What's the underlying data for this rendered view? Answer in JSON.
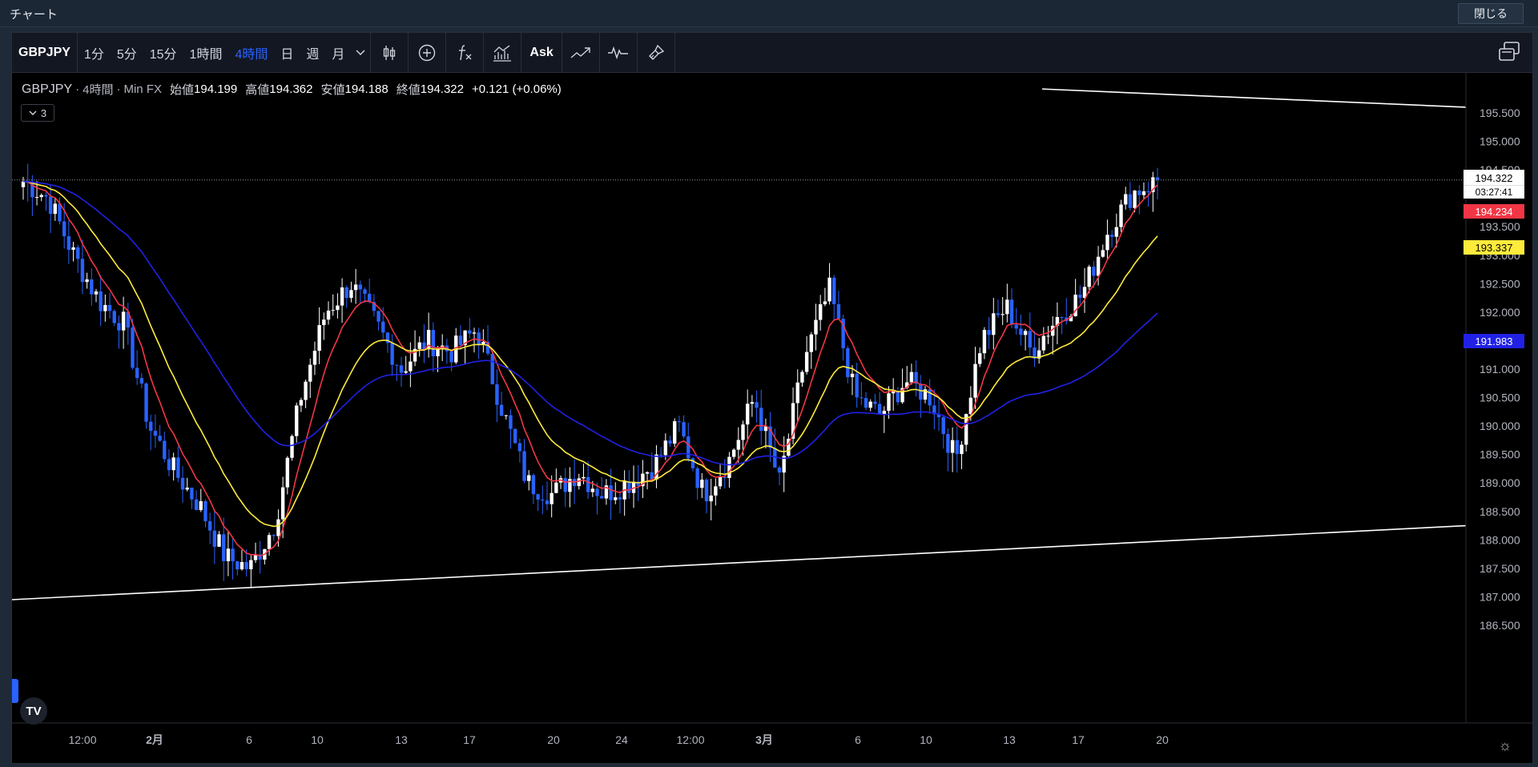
{
  "window": {
    "title": "チャート",
    "close_label": "閉じる"
  },
  "toolbar": {
    "symbol": "GBPJPY",
    "intervals": [
      "1分",
      "5分",
      "15分",
      "1時間",
      "4時間",
      "日",
      "週",
      "月"
    ],
    "active_interval": "4時間",
    "interval_dropdown_icon": "chevron-down-icon",
    "icons": [
      "candles-icon",
      "add-compare-icon",
      "indicators-fx-icon",
      "templates-icon"
    ],
    "ask_label": "Ask",
    "icons_right": [
      "line-tool-icon",
      "replay-icon",
      "brush-icon"
    ],
    "layout_icon": "multi-window-icon"
  },
  "legend": {
    "symbol": "GBPJPY",
    "interval": "4時間",
    "source": "Min FX",
    "open_label": "始値",
    "open": "194.199",
    "high_label": "高値",
    "high": "194.362",
    "low_label": "安値",
    "low": "194.188",
    "close_label": "終値",
    "close": "194.322",
    "change": "+0.121 (+0.06%)",
    "collapse_label": "3"
  },
  "price_tags": {
    "last": "194.322",
    "countdown": "03:27:41",
    "ma_red": "194.234",
    "ma_yellow": "193.337",
    "ma_blue": "191.983"
  },
  "colors": {
    "background": "#000000",
    "up_candle": "#ffffff",
    "down_candle": "#2962ff",
    "ma_fast": "#f23645",
    "ma_mid": "#ffeb3b",
    "ma_slow": "#2121e6",
    "trendline": "#ffffff"
  },
  "chart_data": {
    "type": "candlestick",
    "symbol": "GBPJPY",
    "interval": "4時間",
    "y_axis": {
      "ticks": [
        "195.500",
        "195.000",
        "194.500",
        "193.500",
        "193.000",
        "192.500",
        "192.000",
        "191.500",
        "191.000",
        "190.500",
        "190.000",
        "189.500",
        "189.000",
        "188.500",
        "188.000",
        "187.500",
        "187.000",
        "186.500"
      ],
      "range": [
        186.3,
        195.8
      ]
    },
    "x_axis": {
      "ticks": [
        "12:00",
        "2月",
        "6",
        "10",
        "13",
        "17",
        "20",
        "24",
        "12:00",
        "3月",
        "6",
        "10",
        "13",
        "17",
        "20"
      ],
      "bold_ticks": [
        "2月",
        "3月"
      ]
    },
    "price_anchors": [
      194.3,
      194.0,
      193.0,
      192.2,
      191.8,
      190.0,
      189.2,
      188.6,
      187.7,
      187.5,
      188.3,
      190.5,
      192.0,
      192.5,
      191.8,
      191.0,
      191.5,
      191.3,
      191.7,
      190.3,
      189.0,
      188.8,
      189.2,
      188.8,
      189.0,
      189.3,
      190.0,
      188.8,
      189.4,
      190.5,
      189.0,
      191.2,
      192.4,
      190.5,
      190.2,
      190.8,
      190.5,
      189.4,
      191.5,
      192.1,
      191.3,
      191.9,
      192.3,
      193.4,
      194.1,
      194.3
    ],
    "moving_averages": [
      {
        "color": "red",
        "last": 194.234
      },
      {
        "color": "yellow",
        "last": 193.337
      },
      {
        "color": "blue",
        "last": 191.983
      }
    ],
    "trendlines": [
      {
        "from": {
          "x": "start",
          "y": 186.95
        },
        "to": {
          "x": "end",
          "y": 188.25
        }
      },
      {
        "from": {
          "x": "2/19",
          "y": 195.92
        },
        "to": {
          "x": "end",
          "y": 195.6
        }
      }
    ],
    "last_price": 194.322,
    "grid": false
  }
}
